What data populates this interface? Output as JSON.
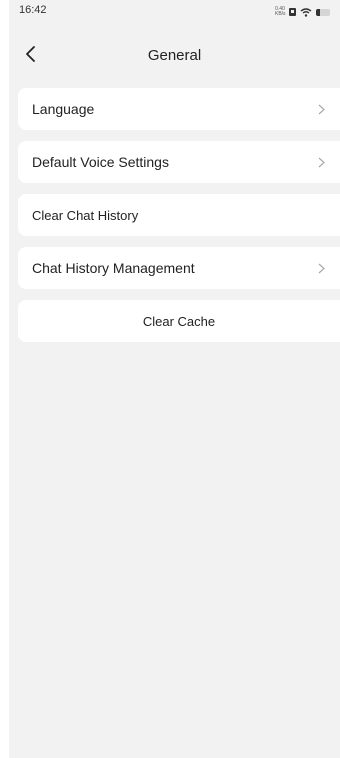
{
  "status_bar": {
    "time": "16:42",
    "net_speed_value": "0.40",
    "net_speed_unit": "KB/s",
    "battery_level": 0.25
  },
  "header": {
    "title": "General"
  },
  "menu": {
    "items": [
      {
        "label": "Language",
        "has_chevron": true
      },
      {
        "label": "Default Voice Settings",
        "has_chevron": true
      },
      {
        "label": "Clear Chat History",
        "has_chevron": false
      },
      {
        "label": "Chat History Management",
        "has_chevron": true
      }
    ],
    "clear_cache_label": "Clear Cache"
  },
  "icons": {
    "back": "chevron-left-icon",
    "item_arrow": "chevron-right-icon",
    "wifi": "wifi-icon",
    "battery": "battery-icon",
    "sim": "sim-icon"
  },
  "colors": {
    "background": "#f2f2f2",
    "card": "#ffffff",
    "text": "#222222",
    "chevron": "#aaaaaa"
  }
}
